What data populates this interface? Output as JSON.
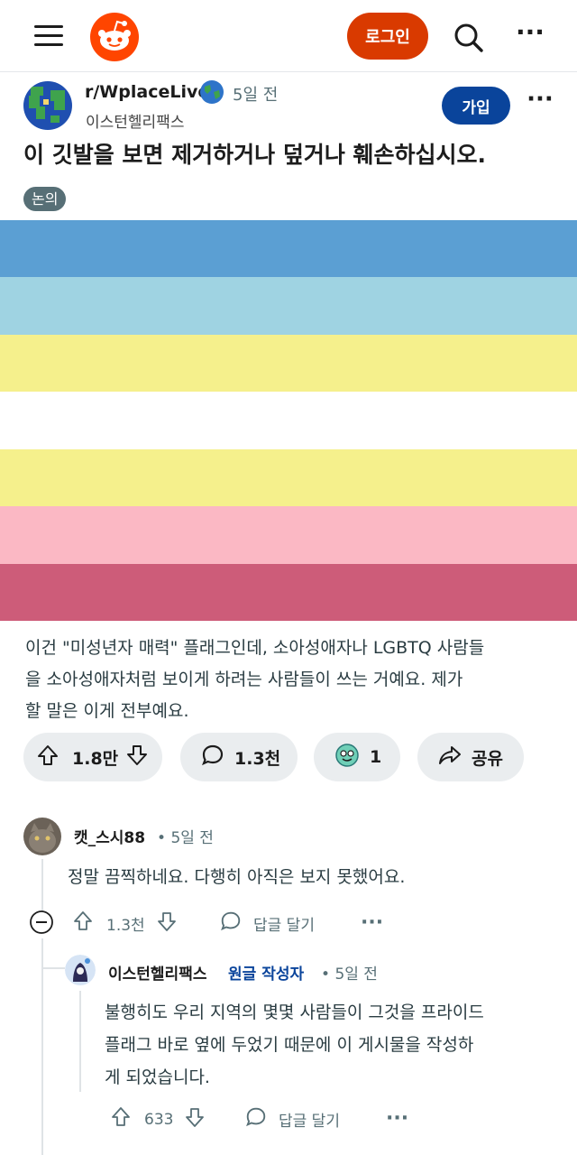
{
  "topbar": {
    "login_label": "로그인"
  },
  "post": {
    "subreddit": "r/WplaceLive",
    "time": "5일 전",
    "author": "이스턴헬리팩스",
    "join_label": "가입",
    "title": "이 깃발을 보면 제거하거나 덮거나 훼손하십시오.",
    "flair": "논의",
    "flag_stripes": [
      "#5b9fd3",
      "#9fd3e2",
      "#f5f08c",
      "#ffffff",
      "#f5f08c",
      "#fbb8c4",
      "#cd5c79"
    ],
    "body_lines": [
      "이건 \"미성년자 매력\" 플래그인데, 소아성애자나 LGBTQ 사람들",
      "을 소아성애자처럼 보이게 하려는 사람들이 쓰는 거예요. 제가",
      "할 말은 이게 전부예요."
    ],
    "votes": "1.8만",
    "comments": "1.3천",
    "awards": "1",
    "share_label": "공유"
  },
  "comments": [
    {
      "author": "캣_스시88",
      "time": "5일 전",
      "text": "정말 끔찍하네요. 다행히 아직은 보지 못했어요.",
      "votes": "1.3천",
      "reply_label": "답글 달기"
    },
    {
      "author": "이스턴헬리팩스",
      "op_badge": "원글 작성자",
      "time": "5일 전",
      "text_lines": [
        "불행히도 우리 지역의 몇몇 사람들이 그것을 프라이드",
        "플래그 바로 옆에 두었기 때문에 이 게시물을 작성하",
        "게 되었습니다."
      ],
      "votes": "633",
      "reply_label": "답글 달기"
    }
  ],
  "colors": {
    "reddit_orange": "#d93a00",
    "join_blue": "#0a449b",
    "pill_bg": "#eaedef",
    "meta_gray": "#576f76"
  }
}
